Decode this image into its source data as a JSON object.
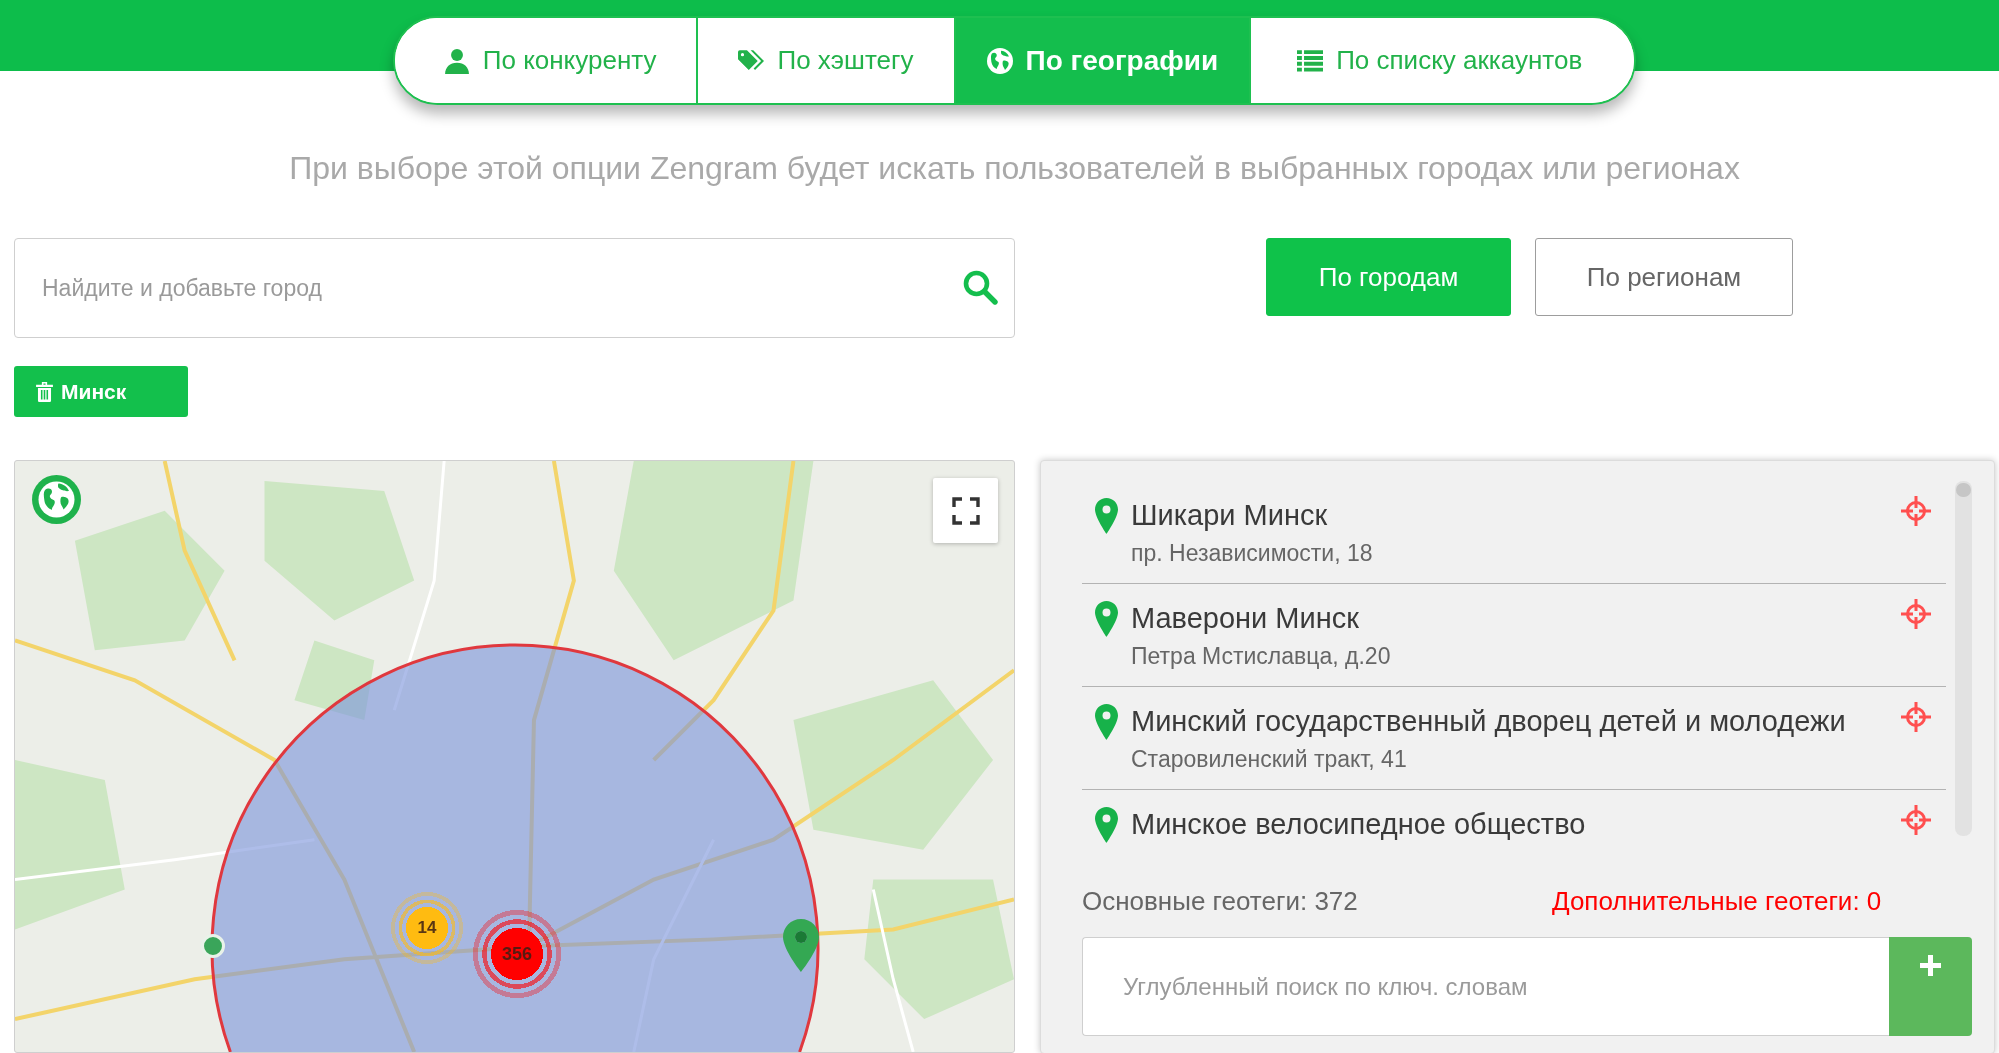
{
  "tabs": [
    {
      "label": "По конкуренту",
      "selected": false
    },
    {
      "label": "По хэштегу",
      "selected": false
    },
    {
      "label": "По географии",
      "selected": true
    },
    {
      "label": "По списку аккаунтов",
      "selected": false
    }
  ],
  "description": "При выборе этой опции Zengram будет искать пользователей в выбранных городах или регионах",
  "city_search": {
    "placeholder": "Найдите и добавьте город"
  },
  "mode_buttons": [
    {
      "label": "По городам",
      "selected": true
    },
    {
      "label": "По регионам",
      "selected": false
    }
  ],
  "selected_cities": [
    {
      "label": "Минск"
    }
  ],
  "map": {
    "clusters": [
      {
        "count": "14",
        "color": "#ffbb11"
      },
      {
        "count": "356",
        "color": "#ff0000"
      }
    ]
  },
  "places": [
    {
      "name": "Шикари Минск",
      "address": "пр. Независимости, 18"
    },
    {
      "name": "Маверони Минск",
      "address": "Петра Мстиславца, д.20"
    },
    {
      "name": "Минский государственный дворец детей и молодежи",
      "address": "Старовиленский тракт, 41"
    },
    {
      "name": "Минское велосипедное общество"
    }
  ],
  "geotags": {
    "main": "Основные геотеги: 372",
    "additional": "Дополнительные геотеги: 0"
  },
  "keyword_search": {
    "placeholder": "Углубленный поиск по ключ. словам"
  }
}
